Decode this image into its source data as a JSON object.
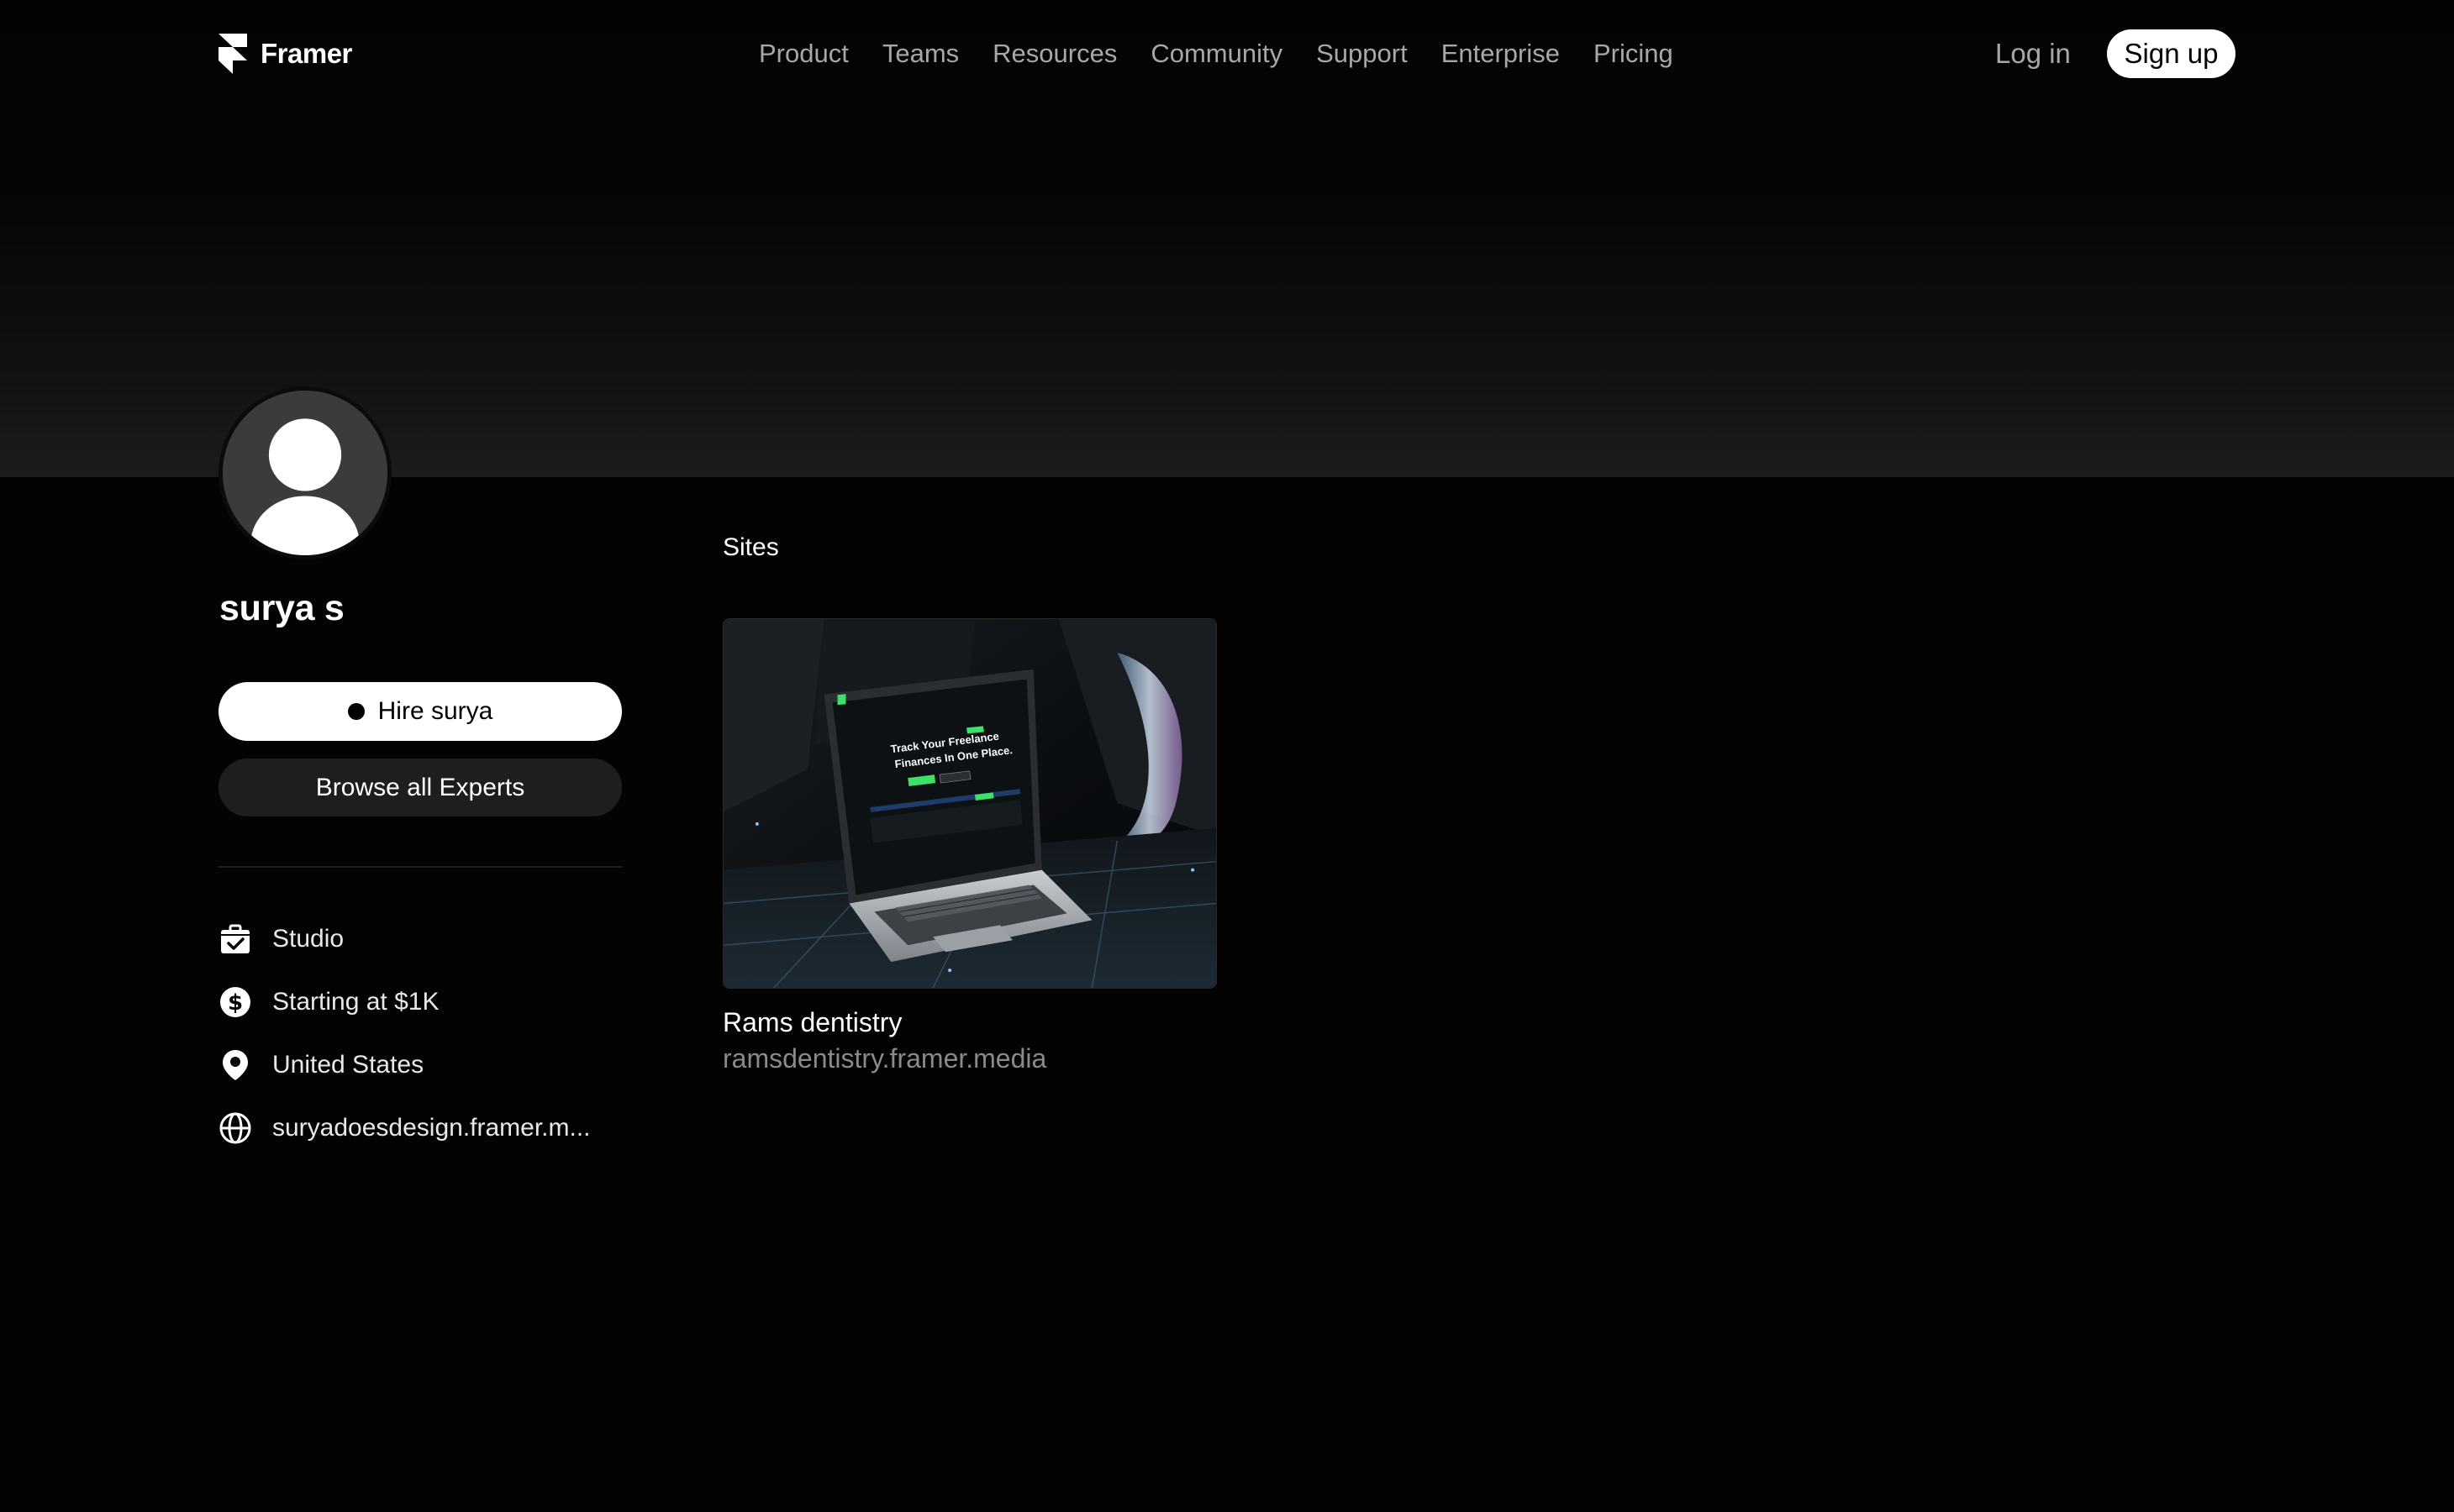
{
  "nav": {
    "brand": "Framer",
    "links": [
      "Product",
      "Teams",
      "Resources",
      "Community",
      "Support",
      "Enterprise",
      "Pricing"
    ],
    "login": "Log in",
    "signup": "Sign up"
  },
  "profile": {
    "name": "surya s",
    "hire_label": "Hire surya",
    "browse_label": "Browse all Experts",
    "details": {
      "type": "Studio",
      "rate": "Starting at $1K",
      "location": "United States",
      "website": "suryadoesdesign.framer.m..."
    }
  },
  "sites": {
    "heading": "Sites",
    "items": [
      {
        "title": "Rams dentistry",
        "url": "ramsdentistry.framer.media",
        "thumbnail": {
          "headline_line1": "Track Your Freelance",
          "headline_line2": "Finances In One Place."
        }
      }
    ]
  },
  "icons": {
    "logo": "framer-logo-icon",
    "type": "briefcase-check-icon",
    "rate": "dollar-circle-icon",
    "location": "map-pin-icon",
    "website": "globe-icon"
  },
  "colors": {
    "background": "#030303",
    "primary_button": "#ffffff",
    "secondary_button": "#1e1e1e",
    "nav_text": "#a8a8a8",
    "muted_text": "#8a8a8a"
  }
}
